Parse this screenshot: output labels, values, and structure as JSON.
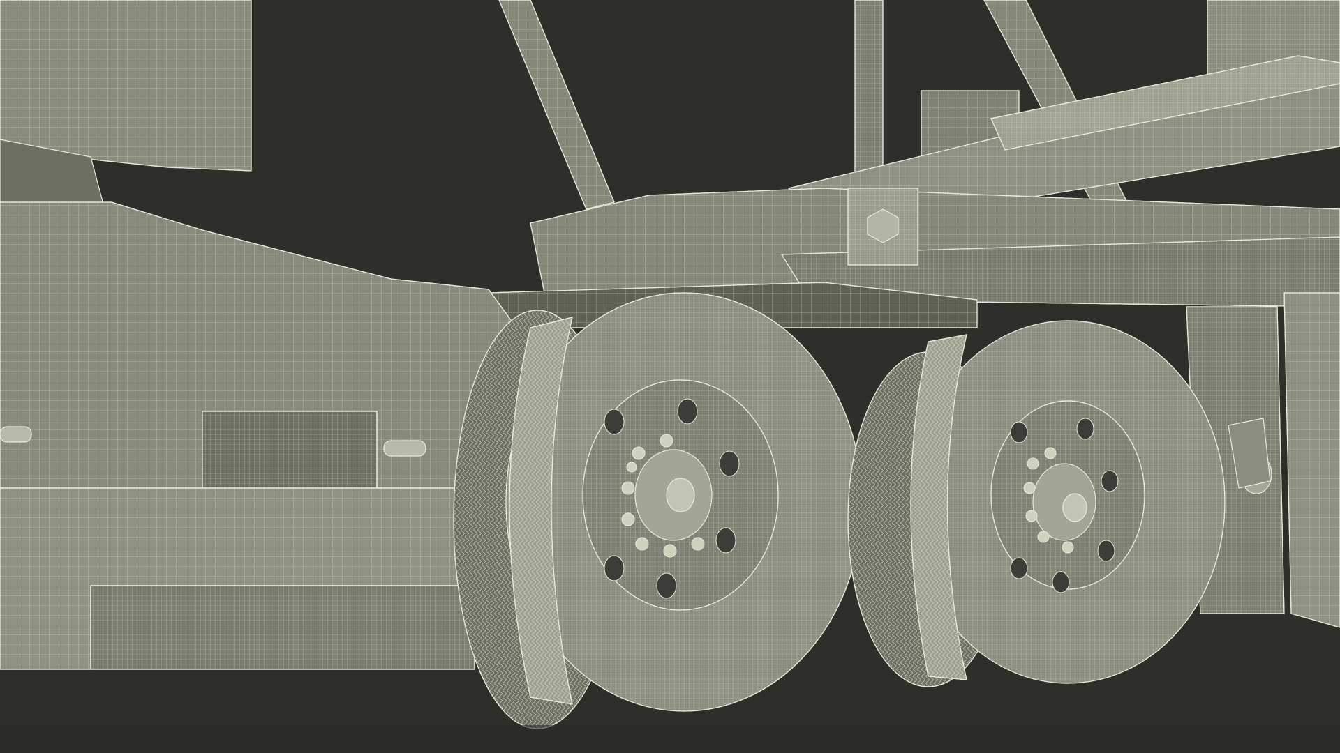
{
  "colors": {
    "background": "#2e2f2b",
    "surface": "#86897a",
    "surface_light": "#9a9d8d",
    "surface_dark": "#6a6c60",
    "wire": "#e9ebdc",
    "shadow": "#4f5148"
  }
}
